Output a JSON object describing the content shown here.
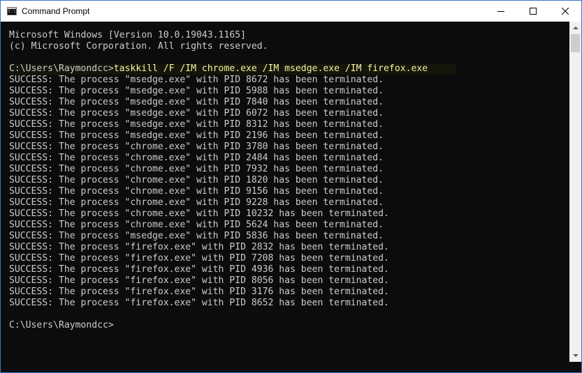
{
  "window": {
    "title": "Command Prompt",
    "icon": "cmd-icon",
    "icon_text": "C:\\."
  },
  "controls": {
    "minimize": "minimize-icon",
    "maximize": "maximize-icon",
    "close": "close-icon"
  },
  "console": {
    "lines": [
      {
        "text": "Microsoft Windows [Version 10.0.19043.1165]"
      },
      {
        "text": "(c) Microsoft Corporation. All rights reserved."
      },
      {
        "text": ""
      },
      {
        "prompt": "C:\\Users\\Raymondcc>",
        "command": "taskkill /F /IM chrome.exe /IM msedge.exe /IM firefox.exe"
      },
      {
        "text": "SUCCESS: The process \"msedge.exe\" with PID 8672 has been terminated."
      },
      {
        "text": "SUCCESS: The process \"msedge.exe\" with PID 5988 has been terminated."
      },
      {
        "text": "SUCCESS: The process \"msedge.exe\" with PID 7840 has been terminated."
      },
      {
        "text": "SUCCESS: The process \"msedge.exe\" with PID 6072 has been terminated."
      },
      {
        "text": "SUCCESS: The process \"msedge.exe\" with PID 8312 has been terminated."
      },
      {
        "text": "SUCCESS: The process \"msedge.exe\" with PID 2196 has been terminated."
      },
      {
        "text": "SUCCESS: The process \"chrome.exe\" with PID 3780 has been terminated."
      },
      {
        "text": "SUCCESS: The process \"chrome.exe\" with PID 2484 has been terminated."
      },
      {
        "text": "SUCCESS: The process \"chrome.exe\" with PID 7932 has been terminated."
      },
      {
        "text": "SUCCESS: The process \"chrome.exe\" with PID 1820 has been terminated."
      },
      {
        "text": "SUCCESS: The process \"chrome.exe\" with PID 9156 has been terminated."
      },
      {
        "text": "SUCCESS: The process \"chrome.exe\" with PID 9228 has been terminated."
      },
      {
        "text": "SUCCESS: The process \"chrome.exe\" with PID 10232 has been terminated."
      },
      {
        "text": "SUCCESS: The process \"chrome.exe\" with PID 5624 has been terminated."
      },
      {
        "text": "SUCCESS: The process \"msedge.exe\" with PID 5836 has been terminated."
      },
      {
        "text": "SUCCESS: The process \"firefox.exe\" with PID 2832 has been terminated."
      },
      {
        "text": "SUCCESS: The process \"firefox.exe\" with PID 7208 has been terminated."
      },
      {
        "text": "SUCCESS: The process \"firefox.exe\" with PID 4936 has been terminated."
      },
      {
        "text": "SUCCESS: The process \"firefox.exe\" with PID 8056 has been terminated."
      },
      {
        "text": "SUCCESS: The process \"firefox.exe\" with PID 3176 has been terminated."
      },
      {
        "text": "SUCCESS: The process \"firefox.exe\" with PID 8652 has been terminated."
      },
      {
        "text": ""
      },
      {
        "text": "C:\\Users\\Raymondcc>"
      }
    ]
  },
  "colors": {
    "console_background": "#0c0c0c",
    "console_text": "#cccccc",
    "command_text": "#f9f1a5",
    "window_border": "#3c78c8"
  }
}
